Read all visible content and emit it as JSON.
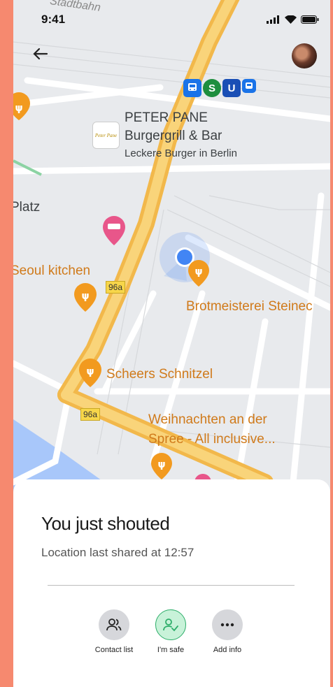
{
  "status_bar": {
    "time": "9:41"
  },
  "map": {
    "street_top": "Stadtbahn",
    "places": {
      "peter_pane_name_1": "PETER PANE",
      "peter_pane_name_2": "Burgergrill & Bar",
      "peter_pane_desc": "Leckere Burger in Berlin",
      "peter_pane_logo_text": "Peter Pane",
      "platz": "Platz",
      "seoul_kitchen": "Seoul kitchen",
      "brotmeisterei": "Brotmeisterei Steinec",
      "scheers": "Scheers Schnitzel",
      "weihnachten_1": "Weihnachten an der",
      "weihnachten_2": "Spree - All inclusive..."
    },
    "road_shield": "96a",
    "transit": {
      "s": "S",
      "u": "U"
    }
  },
  "sheet": {
    "title": "You just shouted",
    "subtitle": "Location last shared at 12:57",
    "actions": {
      "contact_list": "Contact list",
      "im_safe": "I'm safe",
      "add_info": "Add info"
    }
  },
  "colors": {
    "background": "#F6896F",
    "road": "#F7C85C",
    "food_pin": "#F29A1F",
    "hotel_pin": "#E8568A",
    "user_dot": "#4285F4",
    "safe_green": "#2EAE6A"
  }
}
